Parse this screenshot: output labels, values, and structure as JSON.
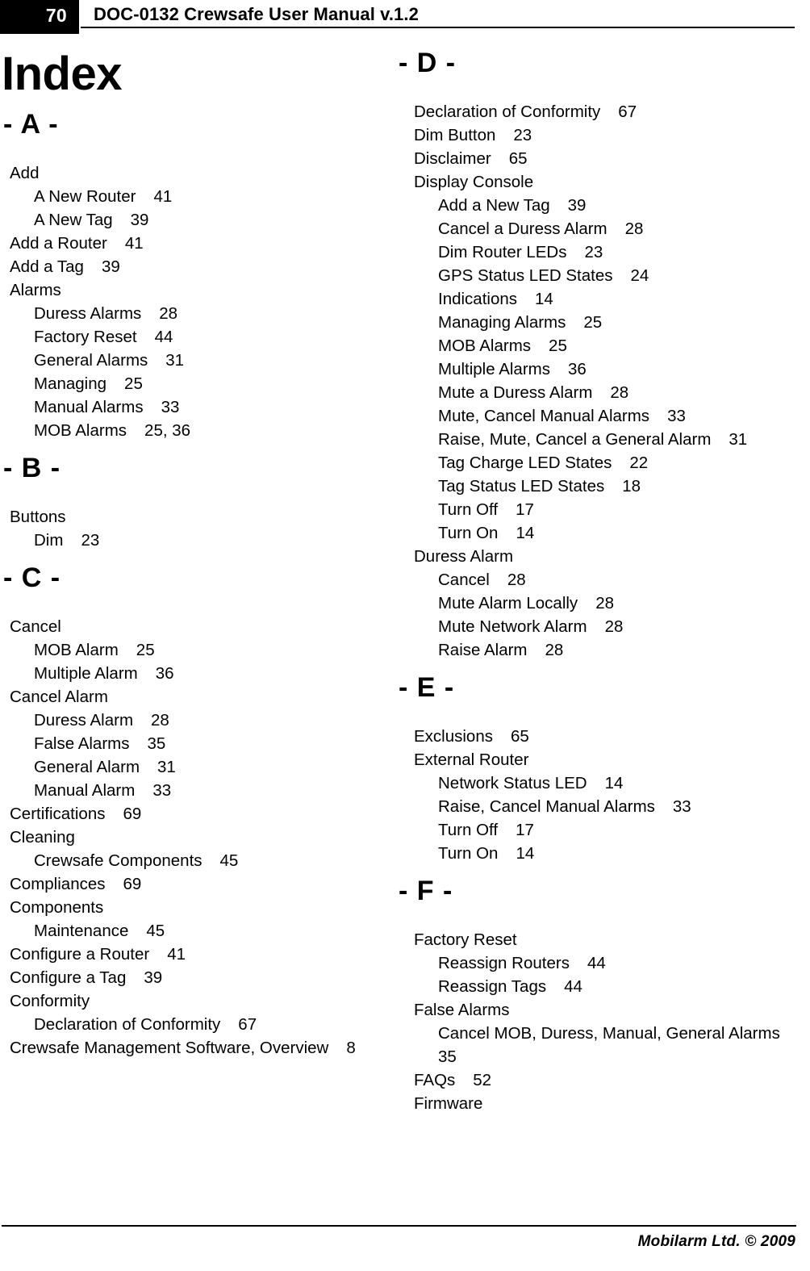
{
  "header": {
    "page_number": "70",
    "title": "DOC-0132 Crewsafe User Manual v.1.2"
  },
  "index": {
    "title": "Index"
  },
  "footer": {
    "text": "Mobilarm Ltd. © 2009"
  },
  "columns": [
    {
      "id": "left",
      "sections": [
        {
          "letter": "- A -",
          "entries": [
            {
              "level": 0,
              "text": "Add",
              "page": ""
            },
            {
              "level": 1,
              "text": "A New Router",
              "page": "41"
            },
            {
              "level": 1,
              "text": "A New Tag",
              "page": "39"
            },
            {
              "level": 0,
              "text": "Add a Router",
              "page": "41"
            },
            {
              "level": 0,
              "text": "Add a Tag",
              "page": "39"
            },
            {
              "level": 0,
              "text": "Alarms",
              "page": ""
            },
            {
              "level": 1,
              "text": "Duress Alarms",
              "page": "28"
            },
            {
              "level": 1,
              "text": "Factory Reset",
              "page": "44"
            },
            {
              "level": 1,
              "text": "General Alarms",
              "page": "31"
            },
            {
              "level": 1,
              "text": "Managing",
              "page": "25"
            },
            {
              "level": 1,
              "text": "Manual Alarms",
              "page": "33"
            },
            {
              "level": 1,
              "text": "MOB Alarms",
              "page": "25, 36"
            }
          ]
        },
        {
          "letter": "- B -",
          "entries": [
            {
              "level": 0,
              "text": "Buttons",
              "page": ""
            },
            {
              "level": 1,
              "text": "Dim",
              "page": "23"
            }
          ]
        },
        {
          "letter": "- C -",
          "entries": [
            {
              "level": 0,
              "text": "Cancel",
              "page": ""
            },
            {
              "level": 1,
              "text": "MOB Alarm",
              "page": "25"
            },
            {
              "level": 1,
              "text": "Multiple Alarm",
              "page": "36"
            },
            {
              "level": 0,
              "text": "Cancel Alarm",
              "page": ""
            },
            {
              "level": 1,
              "text": "Duress Alarm",
              "page": "28"
            },
            {
              "level": 1,
              "text": "False Alarms",
              "page": "35"
            },
            {
              "level": 1,
              "text": "General Alarm",
              "page": "31"
            },
            {
              "level": 1,
              "text": "Manual Alarm",
              "page": "33"
            },
            {
              "level": 0,
              "text": "Certifications",
              "page": "69"
            },
            {
              "level": 0,
              "text": "Cleaning",
              "page": ""
            },
            {
              "level": 1,
              "text": "Crewsafe Components",
              "page": "45"
            },
            {
              "level": 0,
              "text": "Compliances",
              "page": "69"
            },
            {
              "level": 0,
              "text": "Components",
              "page": ""
            },
            {
              "level": 1,
              "text": "Maintenance",
              "page": "45"
            },
            {
              "level": 0,
              "text": "Configure a Router",
              "page": "41"
            },
            {
              "level": 0,
              "text": "Configure a Tag",
              "page": "39"
            },
            {
              "level": 0,
              "text": "Conformity",
              "page": ""
            },
            {
              "level": 1,
              "text": "Declaration of Conformity",
              "page": "67"
            },
            {
              "level": 0,
              "text": "Crewsafe Management Software, Overview",
              "page": "8"
            }
          ]
        }
      ]
    },
    {
      "id": "right",
      "sections": [
        {
          "letter": "- D -",
          "entries": [
            {
              "level": 0,
              "text": "Declaration of Conformity",
              "page": "67"
            },
            {
              "level": 0,
              "text": "Dim Button",
              "page": "23"
            },
            {
              "level": 0,
              "text": "Disclaimer",
              "page": "65"
            },
            {
              "level": 0,
              "text": "Display Console",
              "page": ""
            },
            {
              "level": 1,
              "text": "Add a New Tag",
              "page": "39"
            },
            {
              "level": 1,
              "text": "Cancel a Duress Alarm",
              "page": "28"
            },
            {
              "level": 1,
              "text": "Dim Router LEDs",
              "page": "23"
            },
            {
              "level": 1,
              "text": "GPS Status LED States",
              "page": "24"
            },
            {
              "level": 1,
              "text": "Indications",
              "page": "14"
            },
            {
              "level": 1,
              "text": "Managing Alarms",
              "page": "25"
            },
            {
              "level": 1,
              "text": "MOB Alarms",
              "page": "25"
            },
            {
              "level": 1,
              "text": "Multiple Alarms",
              "page": "36"
            },
            {
              "level": 1,
              "text": "Mute a Duress Alarm",
              "page": "28"
            },
            {
              "level": 1,
              "text": "Mute, Cancel Manual Alarms",
              "page": "33"
            },
            {
              "level": 1,
              "text": "Raise, Mute, Cancel a General Alarm",
              "page": "31"
            },
            {
              "level": 1,
              "text": "Tag Charge LED States",
              "page": "22"
            },
            {
              "level": 1,
              "text": "Tag Status LED States",
              "page": "18"
            },
            {
              "level": 1,
              "text": "Turn Off",
              "page": "17"
            },
            {
              "level": 1,
              "text": "Turn On",
              "page": "14"
            },
            {
              "level": 0,
              "text": "Duress Alarm",
              "page": ""
            },
            {
              "level": 1,
              "text": "Cancel",
              "page": "28"
            },
            {
              "level": 1,
              "text": "Mute Alarm Locally",
              "page": "28"
            },
            {
              "level": 1,
              "text": "Mute Network Alarm",
              "page": "28"
            },
            {
              "level": 1,
              "text": "Raise Alarm",
              "page": "28"
            }
          ]
        },
        {
          "letter": "- E -",
          "entries": [
            {
              "level": 0,
              "text": "Exclusions",
              "page": "65"
            },
            {
              "level": 0,
              "text": "External Router",
              "page": ""
            },
            {
              "level": 1,
              "text": "Network Status LED",
              "page": "14"
            },
            {
              "level": 1,
              "text": "Raise, Cancel Manual Alarms",
              "page": "33"
            },
            {
              "level": 1,
              "text": "Turn Off",
              "page": "17"
            },
            {
              "level": 1,
              "text": "Turn On",
              "page": "14"
            }
          ]
        },
        {
          "letter": "- F -",
          "entries": [
            {
              "level": 0,
              "text": "Factory Reset",
              "page": ""
            },
            {
              "level": 1,
              "text": "Reassign Routers",
              "page": "44"
            },
            {
              "level": 1,
              "text": "Reassign Tags",
              "page": "44"
            },
            {
              "level": 0,
              "text": "False Alarms",
              "page": ""
            },
            {
              "level": 1,
              "text": "Cancel MOB, Duress, Manual, General Alarms",
              "page": "35",
              "wrap": true
            },
            {
              "level": 0,
              "text": "FAQs",
              "page": "52"
            },
            {
              "level": 0,
              "text": "Firmware",
              "page": ""
            }
          ]
        }
      ]
    }
  ]
}
